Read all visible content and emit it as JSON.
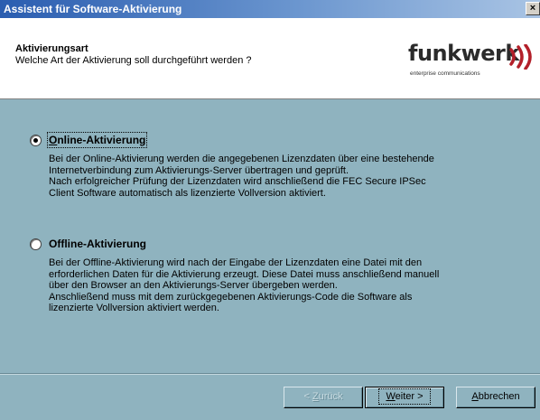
{
  "window": {
    "title": "Assistent für Software-Aktivierung",
    "close_label": "×"
  },
  "header": {
    "title": "Aktivierungsart",
    "subtitle": "Welche Art der Aktivierung soll durchgeführt werden ?",
    "logo_text": "funkwerk",
    "logo_tagline": "enterprise communications",
    "logo_color": "#b3202a"
  },
  "options": [
    {
      "label_first": "O",
      "label_rest": "nline-Aktivierung",
      "selected": true,
      "description": [
        "Bei der Online-Aktivierung werden die angegebenen Lizenzdaten über eine bestehende",
        "Internetverbindung zum Aktivierungs-Server übertragen und geprüft.",
        "Nach erfolgreicher Prüfung der Lizenzdaten wird anschließend die FEC Secure IPSec",
        "Client Software automatisch als lizenzierte Vollversion aktiviert."
      ]
    },
    {
      "label_first": "O",
      "label_rest": "ffline-Aktivierung",
      "selected": false,
      "description": [
        "Bei der Offline-Aktivierung wird nach der Eingabe der Lizenzdaten eine Datei mit den",
        "erforderlichen Daten für die Aktivierung erzeugt. Diese Datei muss anschließend manuell",
        "über den Browser an den Aktivierungs-Server übergeben werden.",
        "Anschließend muss mit dem zurückgegebenen Aktivierungs-Code die Software als",
        "lizenzierte Vollversion aktiviert werden."
      ]
    }
  ],
  "buttons": {
    "back_prefix": "< ",
    "back_key": "Z",
    "back_rest": "urück",
    "next_key": "W",
    "next_rest": "eiter >",
    "cancel_key": "A",
    "cancel_rest": "bbrechen"
  }
}
